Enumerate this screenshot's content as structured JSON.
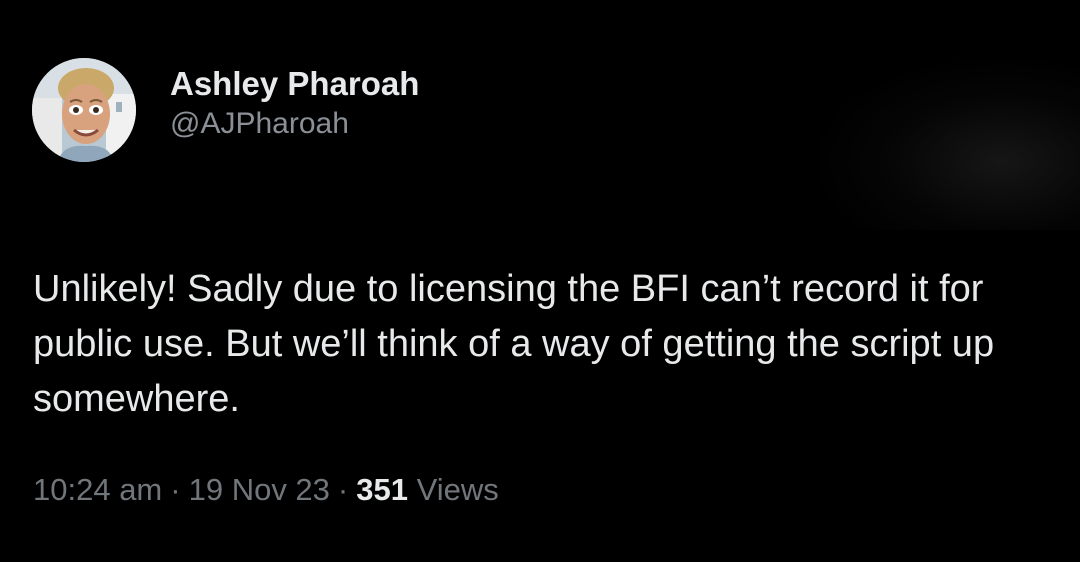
{
  "author": {
    "display_name": "Ashley Pharoah",
    "handle": "@AJPharoah"
  },
  "tweet": {
    "text": "Unlikely! Sadly due to licensing the BFI can’t record it for public use. But we’ll think of a way of getting the script up somewhere.",
    "time": "10:24 am",
    "separator": "·",
    "date": "19 Nov 23",
    "views_count": "351",
    "views_label": "Views"
  },
  "colors": {
    "background": "#000000",
    "primary_text": "#e7e9ea",
    "secondary_text": "#71767b"
  },
  "icons": {
    "avatar": "profile-photo-icon"
  }
}
